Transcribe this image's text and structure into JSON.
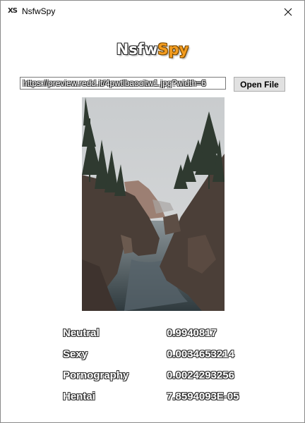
{
  "window": {
    "title": "NsfwSpy",
    "app_icon_text": "XS"
  },
  "logo": {
    "part1": "Nsfw",
    "part2": "Spy",
    "accent_color": "#f39c1f"
  },
  "url_input": {
    "value": "https://preview.redd.it/4pwtlbaocitw1.jpg?width=6"
  },
  "open_button": {
    "label": "Open File"
  },
  "image": {
    "description_icon": "photo-coastal-cliffs"
  },
  "results": [
    {
      "label": "Neutral",
      "value": "0.9940817"
    },
    {
      "label": "Sexy",
      "value": "0.0034653214"
    },
    {
      "label": "Pornography",
      "value": "0.0024293256"
    },
    {
      "label": "Hentai",
      "value": "7.8594093E-05"
    }
  ]
}
